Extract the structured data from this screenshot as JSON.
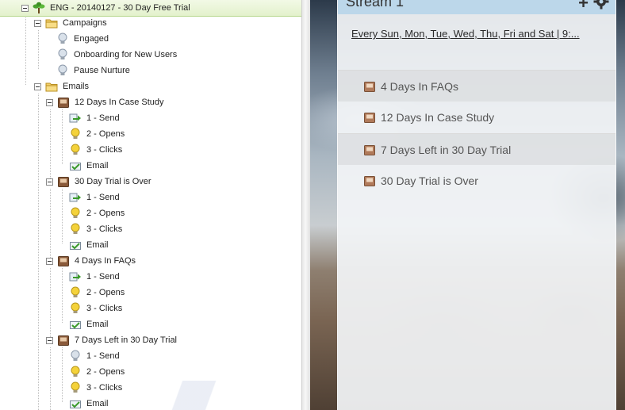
{
  "tree": {
    "root": {
      "label": "ENG - 20140127 - 30 Day Free Trial",
      "icon": "program-icon"
    },
    "campaigns_folder": {
      "label": "Campaigns",
      "icon": "folder-icon"
    },
    "campaigns": [
      {
        "label": "Engaged",
        "icon": "smart-campaign-bulb-icon"
      },
      {
        "label": "Onboarding for New Users",
        "icon": "smart-campaign-bulb-icon"
      },
      {
        "label": "Pause Nurture",
        "icon": "smart-campaign-bulb-icon"
      }
    ],
    "emails_folder": {
      "label": "Emails",
      "icon": "folder-icon"
    },
    "email_programs": [
      {
        "label": "12 Days In Case Study",
        "children": [
          "1 - Send",
          "2 - Opens",
          "3 - Clicks",
          "Email"
        ]
      },
      {
        "label": "30 Day Trial is Over",
        "children": [
          "1 - Send",
          "2 - Opens",
          "3 - Clicks",
          "Email"
        ]
      },
      {
        "label": "4 Days In FAQs",
        "children": [
          "1 - Send",
          "2 - Opens",
          "3 - Clicks",
          "Email"
        ]
      },
      {
        "label": "7 Days Left in 30 Day Trial",
        "children": [
          "1 - Send",
          "2 - Opens",
          "3 - Clicks",
          "Email"
        ]
      }
    ]
  },
  "stream": {
    "title": "Stream 1",
    "add_label": "+",
    "schedule": "Every Sun, Mon, Tue, Wed, Thu, Fri and Sat | 9:...",
    "items": [
      {
        "label": "4 Days In FAQs"
      },
      {
        "label": "12 Days In Case Study"
      },
      {
        "label": "7 Days Left in 30 Day Trial"
      },
      {
        "label": "30 Day Trial is Over"
      }
    ]
  },
  "colors": {
    "root_highlight": "#e3f1cc",
    "stream_header": "#bcd7ea",
    "bulb_active": "#f4d23a",
    "bulb_inactive": "#aab6c6",
    "send_arrow": "#3a9a2a"
  }
}
